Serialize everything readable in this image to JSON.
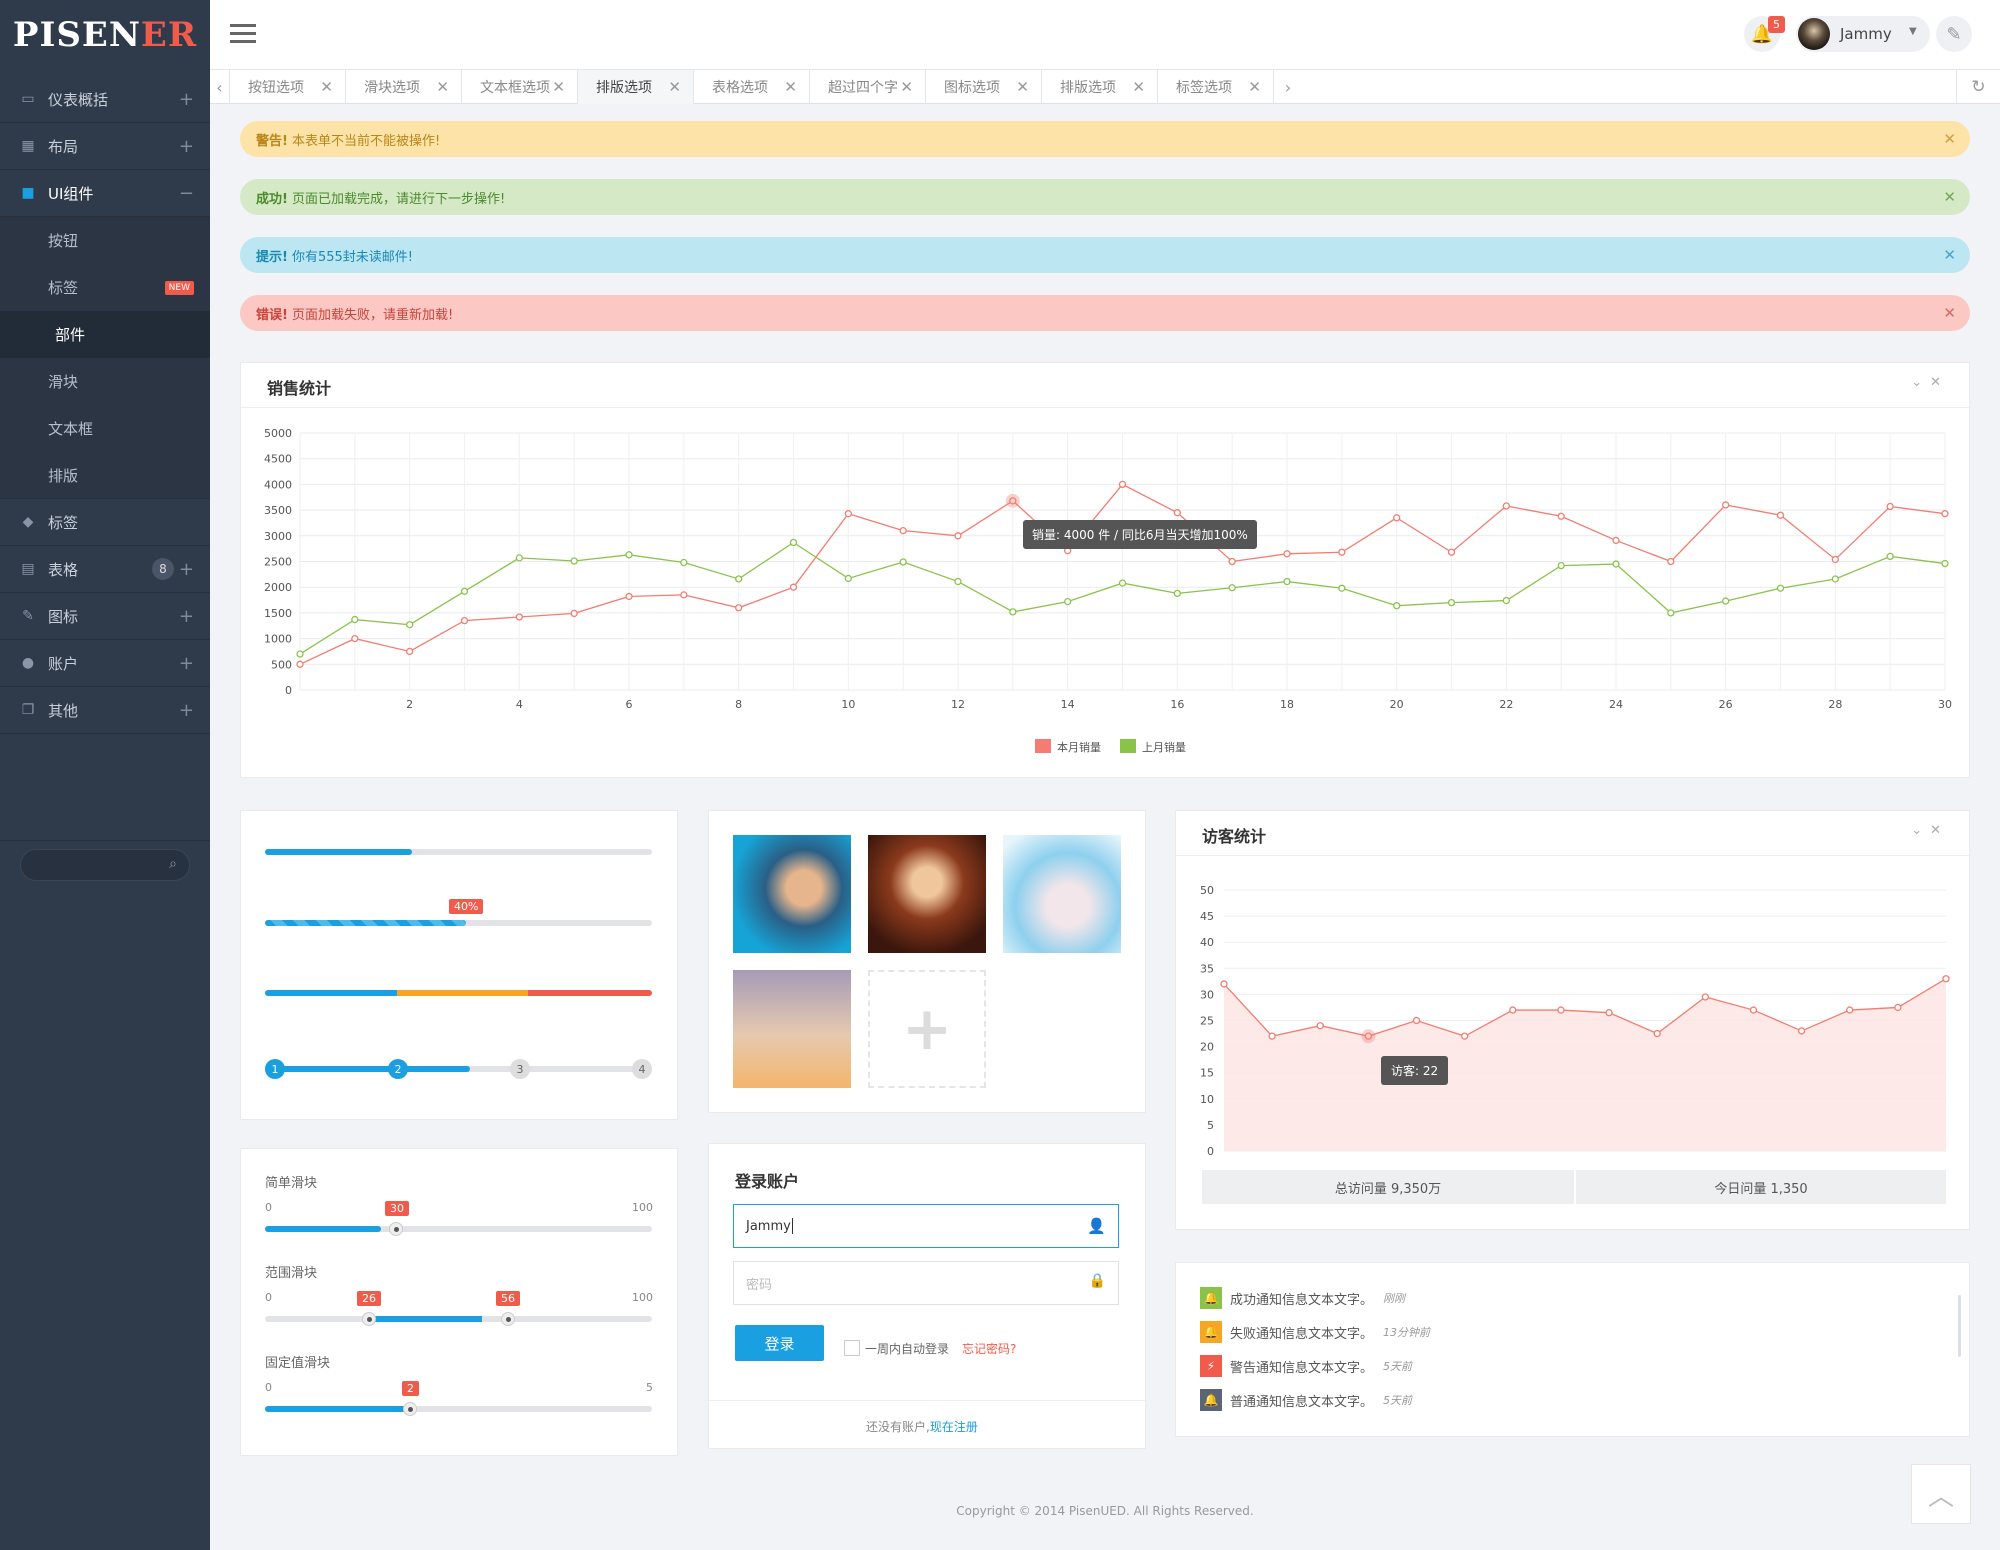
{
  "app": {
    "logo_main": "PISEN",
    "logo_accent": "ER",
    "user_name": "Jammy",
    "notification_count": "5",
    "colors": {
      "accent": "#1aa0e0",
      "danger": "#f15b4c",
      "success": "#8bc34a",
      "sidebar": "#2f3a4b"
    }
  },
  "sidebar": {
    "items": [
      {
        "label": "仪表概括",
        "icon": "monitor-icon"
      },
      {
        "label": "布局",
        "icon": "layout-icon"
      },
      {
        "label": "UI组件",
        "icon": "book-icon"
      },
      {
        "label": "标签",
        "icon": "tag-icon"
      },
      {
        "label": "表格",
        "icon": "table-icon",
        "badge": "8"
      },
      {
        "label": "图标",
        "icon": "brush-icon"
      },
      {
        "label": "账户",
        "icon": "user-icon"
      },
      {
        "label": "其他",
        "icon": "copy-icon"
      }
    ],
    "sub_items": [
      {
        "label": "按钮"
      },
      {
        "label": "标签",
        "badge": "NEW"
      },
      {
        "label": "部件"
      },
      {
        "label": "滑块"
      },
      {
        "label": "文本框"
      },
      {
        "label": "排版"
      }
    ]
  },
  "tabs": [
    "按钮选项",
    "滑块选项",
    "文本框选项",
    "排版选项",
    "表格选项",
    "超过四个字",
    "图标选项",
    "排版选项",
    "标签选项"
  ],
  "alerts": [
    {
      "strong": "警告!",
      "text": "本表单不当前不能被操作!"
    },
    {
      "strong": "成功!",
      "text": "页面已加载完成，请进行下一步操作!"
    },
    {
      "strong": "提示!",
      "text": "你有555封未读邮件!"
    },
    {
      "strong": "错误!",
      "text": "页面加载失败，请重新加载!"
    }
  ],
  "sales_panel": {
    "title": "销售统计",
    "tooltip": "销量: 4000 件 / 同比6月当天增加100%"
  },
  "visitor_panel": {
    "title": "访客统计",
    "tooltip": "访客: 22",
    "total_label": "总访问量 9,350万",
    "today_label": "今日问量 1,350"
  },
  "chart_data": [
    {
      "type": "line",
      "title": "销售统计",
      "x": [
        0,
        1,
        2,
        3,
        4,
        5,
        6,
        7,
        8,
        9,
        10,
        11,
        12,
        13,
        14,
        15,
        16,
        17,
        18,
        19,
        20,
        21,
        22,
        23,
        24,
        25,
        26,
        27,
        28,
        29,
        30
      ],
      "xticks": [
        2,
        4,
        6,
        8,
        10,
        12,
        14,
        16,
        18,
        20,
        22,
        24,
        26,
        28,
        30
      ],
      "ylim": [
        0,
        5000
      ],
      "yticks": [
        0,
        500,
        1000,
        1500,
        2000,
        2500,
        3000,
        3500,
        4000,
        4500,
        5000
      ],
      "legend": "bottom",
      "grid": true,
      "series": [
        {
          "name": "本月销量",
          "color": "#f47c70",
          "values": [
            500,
            1000,
            750,
            1350,
            1420,
            1490,
            1820,
            1850,
            1600,
            2000,
            3430,
            3100,
            3000,
            3680,
            2710,
            4000,
            3450,
            2500,
            2650,
            2680,
            3350,
            2680,
            3580,
            3380,
            2910,
            2500,
            3600,
            3400,
            2540,
            3570,
            3430
          ]
        },
        {
          "name": "上月销量",
          "color": "#8bc34a",
          "values": [
            700,
            1370,
            1270,
            1920,
            2570,
            2510,
            2630,
            2480,
            2160,
            2870,
            2170,
            2490,
            2110,
            1520,
            1720,
            2080,
            1880,
            1990,
            2110,
            1980,
            1640,
            1700,
            1740,
            2420,
            2450,
            1500,
            1730,
            1980,
            2160,
            2600,
            2460
          ]
        }
      ]
    },
    {
      "type": "area",
      "title": "访客统计",
      "x": [
        0,
        1,
        2,
        3,
        4,
        5,
        6,
        7,
        8,
        9,
        10,
        11,
        12,
        13,
        14,
        15
      ],
      "ylim": [
        0,
        50
      ],
      "yticks": [
        0,
        5,
        10,
        15,
        20,
        25,
        30,
        35,
        40,
        45,
        50
      ],
      "grid": true,
      "series": [
        {
          "name": "",
          "color": "#f47c70",
          "values": [
            32,
            22,
            24,
            22,
            25,
            22,
            27,
            27,
            26.5,
            22.5,
            29.5,
            27,
            23,
            27,
            27.5,
            33
          ]
        }
      ]
    }
  ],
  "progress": {
    "label_40": "40%",
    "steps": [
      "1",
      "2",
      "3",
      "4"
    ]
  },
  "sliders": {
    "simple": {
      "label": "简单滑块",
      "min": "0",
      "max": "100",
      "value": "30"
    },
    "range": {
      "label": "范围滑块",
      "min": "0",
      "max": "100",
      "low": "26",
      "high": "56"
    },
    "fixed": {
      "label": "固定值滑块",
      "min": "0",
      "max": "5",
      "value": "2"
    }
  },
  "login": {
    "title": "登录账户",
    "username": "Jammy",
    "password_placeholder": "密码",
    "submit": "登录",
    "remember": "一周内自动登录",
    "forgot": "忘记密码?",
    "no_account": "还没有账户,",
    "register": "现在注册"
  },
  "notifications": [
    {
      "text": "成功通知信息文本文字。",
      "time": "刚刚",
      "color": "#8bc34a",
      "icon": "bell-icon"
    },
    {
      "text": "失败通知信息文本文字。",
      "time": "13分钟前",
      "color": "#f5a623",
      "icon": "bell-icon"
    },
    {
      "text": "警告通知信息文本文字。",
      "time": "5天前",
      "color": "#f15b4c",
      "icon": "bolt-icon"
    },
    {
      "text": "普通通知信息文本文字。",
      "time": "5天前",
      "color": "#5b6575",
      "icon": "bell-icon"
    }
  ],
  "footer": "Copyright © 2014 PisenUED. All Rights Reserved."
}
